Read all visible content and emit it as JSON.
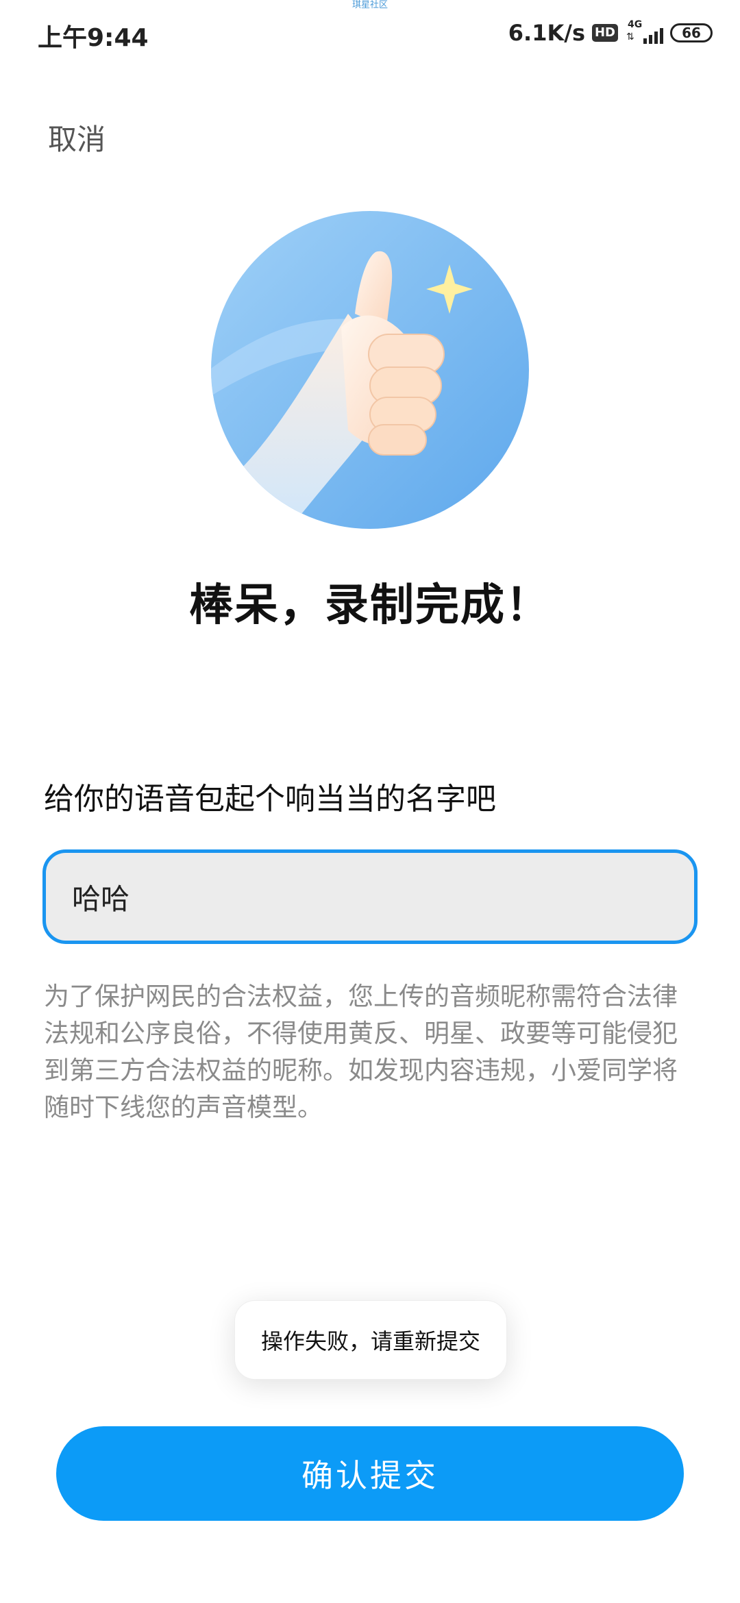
{
  "watermark": "琪星社区",
  "status_bar": {
    "time": "上午9:44",
    "net_speed": "6.1K/s",
    "hd_badge": "HD",
    "network_type": "4G",
    "battery": "66"
  },
  "header": {
    "cancel_label": "取消"
  },
  "illustration": {
    "icon": "thumbs-up-icon",
    "colors": {
      "circle": "#7ab8f0",
      "sparkle": "#fff0a0",
      "hand": "#fde0c8"
    }
  },
  "headline": "棒呆，录制完成！",
  "name_section": {
    "prompt": "给你的语音包起个响当当的名字吧",
    "input_value": "哈哈"
  },
  "notice": "为了保护网民的合法权益，您上传的音频昵称需符合法律法规和公序良俗，不得使用黄反、明星、政要等可能侵犯到第三方合法权益的昵称。如发现内容违规，小爱同学将随时下线您的声音模型。",
  "toast": "操作失败，请重新提交",
  "submit_label": "确认提交",
  "colors": {
    "accent": "#0c9bf7",
    "input_border": "#1a95f0",
    "input_bg": "#ececec",
    "notice_text": "#8a8a8a"
  }
}
